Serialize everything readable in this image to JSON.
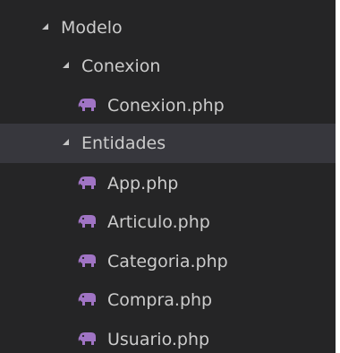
{
  "tree": {
    "items": [
      {
        "label": "Modelo",
        "type": "folder",
        "expanded": true,
        "level": 0
      },
      {
        "label": "Conexion",
        "type": "folder",
        "expanded": true,
        "level": 1
      },
      {
        "label": "Conexion.php",
        "type": "file",
        "icon": "php-elephant-icon",
        "level": 2
      },
      {
        "label": "Entidades",
        "type": "folder",
        "expanded": true,
        "level": 1,
        "selected": true
      },
      {
        "label": "App.php",
        "type": "file",
        "icon": "php-elephant-icon",
        "level": 2
      },
      {
        "label": "Articulo.php",
        "type": "file",
        "icon": "php-elephant-icon",
        "level": 2
      },
      {
        "label": "Categoria.php",
        "type": "file",
        "icon": "php-elephant-icon",
        "level": 2
      },
      {
        "label": "Compra.php",
        "type": "file",
        "icon": "php-elephant-icon",
        "level": 2
      },
      {
        "label": "Usuario.php",
        "type": "file",
        "icon": "php-elephant-icon",
        "level": 2
      }
    ]
  },
  "colors": {
    "background": "#252526",
    "text": "#cccccc",
    "selected_row": "#37373d",
    "php_icon": "#a074c4"
  }
}
